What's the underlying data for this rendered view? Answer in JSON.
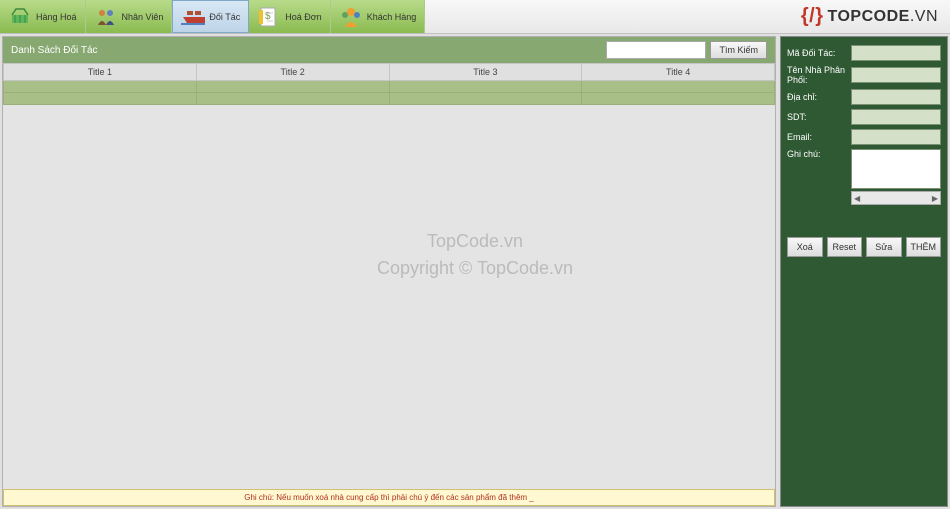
{
  "toolbar": {
    "tabs": [
      {
        "label": "Hàng Hoá",
        "icon": "basket"
      },
      {
        "label": "Nhân Viên",
        "icon": "people"
      },
      {
        "label": "Đối Tác",
        "icon": "ship",
        "active": true
      },
      {
        "label": "Hoá Đơn",
        "icon": "invoice"
      },
      {
        "label": "Khách Hàng",
        "icon": "customer"
      }
    ],
    "logo_bracket": "{/}",
    "logo_main": "TOPCODE",
    "logo_suffix": ".VN"
  },
  "left": {
    "title": "Danh Sách Đối Tác",
    "search_btn": "Tìm Kiếm",
    "columns": [
      "Title 1",
      "Title 2",
      "Title 3",
      "Title 4"
    ],
    "footer": "Ghi chú: Nếu muốn xoá nhà cung cấp thì phải chú ý đến các sản phẩm đã thêm _"
  },
  "form": {
    "fields": {
      "ma": "Mã Đối Tác:",
      "ten": "Tên Nhà Phân Phối:",
      "diachi": "Địa chỉ:",
      "sdt": "SDT:",
      "email": "Email:",
      "ghichu": "Ghi chú:"
    },
    "buttons": {
      "xoa": "Xoá",
      "reset": "Reset",
      "sua": "Sửa",
      "them": "THÊM"
    }
  },
  "watermark": {
    "l1": "TopCode.vn",
    "l2": "Copyright © TopCode.vn"
  }
}
